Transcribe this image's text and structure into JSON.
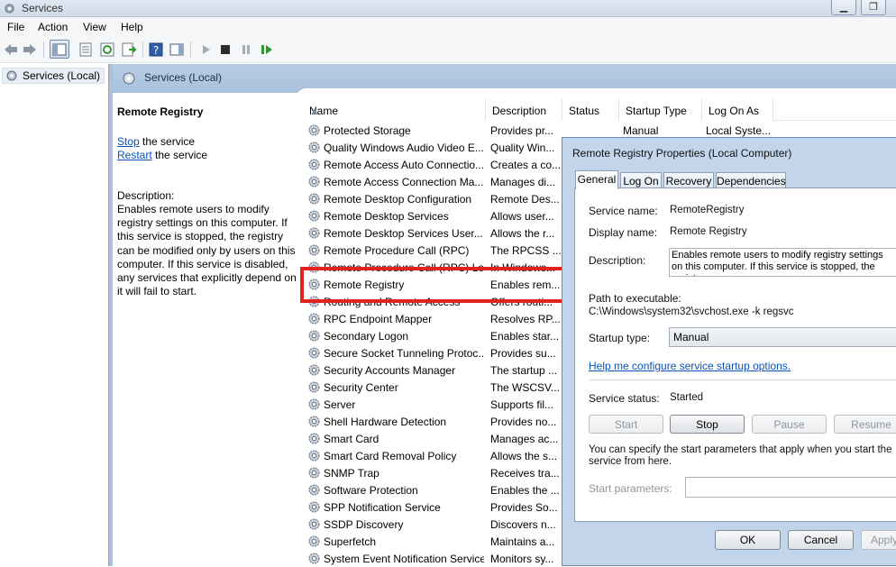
{
  "window": {
    "title": "Services"
  },
  "menu": [
    "File",
    "Action",
    "View",
    "Help"
  ],
  "tree": {
    "root_label": "Services (Local)"
  },
  "pane": {
    "header": "Services (Local)"
  },
  "details": {
    "service_name": "Remote Registry",
    "stop_link": "Stop",
    "stop_suffix": " the service",
    "restart_link": "Restart",
    "restart_suffix": " the service",
    "description_label": "Description:",
    "description": "Enables remote users to modify registry settings on this computer. If this service is stopped, the registry can be modified only by users on this computer. If this service is disabled, any services that explicitly depend on it will fail to start."
  },
  "columns": [
    "Name",
    "Description",
    "Status",
    "Startup Type",
    "Log On As"
  ],
  "services": [
    {
      "name": "Protected Storage",
      "desc": "Provides pr...",
      "status": "",
      "startup": "Manual",
      "logon": "Local Syste..."
    },
    {
      "name": "Quality Windows Audio Video E...",
      "desc": "Quality Win...",
      "status": "",
      "startup": "",
      "logon": ""
    },
    {
      "name": "Remote Access Auto Connectio...",
      "desc": "Creates a co...",
      "status": "",
      "startup": "",
      "logon": ""
    },
    {
      "name": "Remote Access Connection Ma...",
      "desc": "Manages di...",
      "status": "",
      "startup": "",
      "logon": ""
    },
    {
      "name": "Remote Desktop Configuration",
      "desc": "Remote Des...",
      "status": "",
      "startup": "",
      "logon": ""
    },
    {
      "name": "Remote Desktop Services",
      "desc": "Allows user...",
      "status": "",
      "startup": "",
      "logon": ""
    },
    {
      "name": "Remote Desktop Services User...",
      "desc": "Allows the r...",
      "status": "",
      "startup": "",
      "logon": ""
    },
    {
      "name": "Remote Procedure Call (RPC)",
      "desc": "The RPCSS ...",
      "status": "",
      "startup": "",
      "logon": ""
    },
    {
      "name": "Remote Procedure Call (RPC) Lo...",
      "desc": "In Windows...",
      "status": "",
      "startup": "",
      "logon": ""
    },
    {
      "name": "Remote Registry",
      "desc": "Enables rem...",
      "status": "",
      "startup": "",
      "logon": ""
    },
    {
      "name": "Routing and Remote Access",
      "desc": "Offers routi...",
      "status": "",
      "startup": "",
      "logon": ""
    },
    {
      "name": "RPC Endpoint Mapper",
      "desc": "Resolves RP...",
      "status": "",
      "startup": "",
      "logon": ""
    },
    {
      "name": "Secondary Logon",
      "desc": "Enables star...",
      "status": "",
      "startup": "",
      "logon": ""
    },
    {
      "name": "Secure Socket Tunneling Protoc...",
      "desc": "Provides su...",
      "status": "",
      "startup": "",
      "logon": ""
    },
    {
      "name": "Security Accounts Manager",
      "desc": "The startup ...",
      "status": "",
      "startup": "",
      "logon": ""
    },
    {
      "name": "Security Center",
      "desc": "The WSCSV...",
      "status": "",
      "startup": "",
      "logon": ""
    },
    {
      "name": "Server",
      "desc": "Supports fil...",
      "status": "",
      "startup": "",
      "logon": ""
    },
    {
      "name": "Shell Hardware Detection",
      "desc": "Provides no...",
      "status": "",
      "startup": "",
      "logon": ""
    },
    {
      "name": "Smart Card",
      "desc": "Manages ac...",
      "status": "",
      "startup": "",
      "logon": ""
    },
    {
      "name": "Smart Card Removal Policy",
      "desc": "Allows the s...",
      "status": "",
      "startup": "",
      "logon": ""
    },
    {
      "name": "SNMP Trap",
      "desc": "Receives tra...",
      "status": "",
      "startup": "",
      "logon": ""
    },
    {
      "name": "Software Protection",
      "desc": "Enables the ...",
      "status": "",
      "startup": "",
      "logon": ""
    },
    {
      "name": "SPP Notification Service",
      "desc": "Provides So...",
      "status": "",
      "startup": "",
      "logon": ""
    },
    {
      "name": "SSDP Discovery",
      "desc": "Discovers n...",
      "status": "",
      "startup": "",
      "logon": ""
    },
    {
      "name": "Superfetch",
      "desc": "Maintains a...",
      "status": "",
      "startup": "",
      "logon": ""
    },
    {
      "name": "System Event Notification Service",
      "desc": "Monitors sy...",
      "status": "",
      "startup": "",
      "logon": ""
    }
  ],
  "dialog": {
    "title": "Remote Registry Properties (Local Computer)",
    "tabs": [
      "General",
      "Log On",
      "Recovery",
      "Dependencies"
    ],
    "service_name_label": "Service name:",
    "service_name_value": "RemoteRegistry",
    "display_name_label": "Display name:",
    "display_name_value": "Remote Registry",
    "description_label": "Description:",
    "description_value": "Enables remote users to modify registry settings on this computer. If this service is stopped, the registry",
    "path_label": "Path to executable:",
    "path_value": "C:\\Windows\\system32\\svchost.exe -k regsvc",
    "startup_type_label": "Startup type:",
    "startup_type_value": "Manual",
    "help_link": "Help me configure service startup options.",
    "status_label": "Service status:",
    "status_value": "Started",
    "buttons": {
      "start": "Start",
      "stop": "Stop",
      "pause": "Pause",
      "resume": "Resume"
    },
    "params_note": "You can specify the start parameters that apply when you start the service from here.",
    "params_label": "Start parameters:",
    "params_value": "",
    "ok": "OK",
    "cancel": "Cancel",
    "apply": "Apply"
  },
  "colors": {
    "highlight": "#e3211e",
    "link": "#0a51b8",
    "pane_header": "#b8cde4"
  }
}
